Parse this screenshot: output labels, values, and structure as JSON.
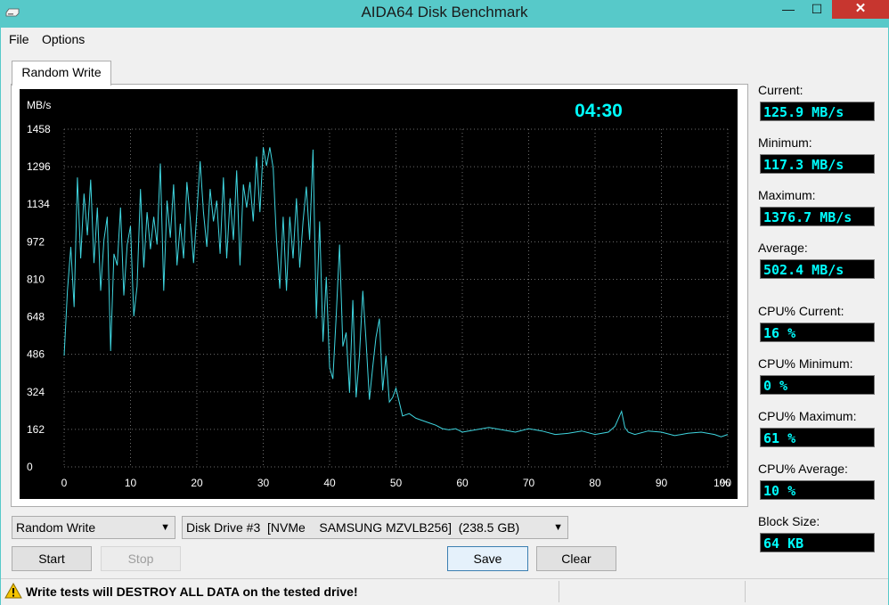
{
  "window": {
    "title": "AIDA64 Disk Benchmark",
    "min_glyph": "—",
    "max_glyph": "☐",
    "close_glyph": "✕"
  },
  "menu": [
    "File",
    "Options"
  ],
  "tab": {
    "label": "Random Write"
  },
  "timer": "04:30",
  "stats": [
    {
      "label": "Current:",
      "value": "125.9 MB/s"
    },
    {
      "label": "Minimum:",
      "value": "117.3 MB/s"
    },
    {
      "label": "Maximum:",
      "value": "1376.7 MB/s"
    },
    {
      "label": "Average:",
      "value": "502.4 MB/s"
    },
    {
      "label": "CPU% Current:",
      "value": "16 %"
    },
    {
      "label": "CPU% Minimum:",
      "value": "0 %"
    },
    {
      "label": "CPU% Maximum:",
      "value": "61 %"
    },
    {
      "label": "CPU% Average:",
      "value": "10 %"
    },
    {
      "label": "Block Size:",
      "value": "64 KB"
    }
  ],
  "controls": {
    "test_select": "Random Write",
    "drive_select": "Disk Drive #3  [NVMe    SAMSUNG MZVLB256]  (238.5 GB)",
    "start": "Start",
    "stop": "Stop",
    "save": "Save",
    "clear": "Clear"
  },
  "status": {
    "warning": "Write tests will DESTROY ALL DATA on the tested drive!"
  },
  "colors": {
    "trace": "#3fd6e0",
    "grid": "#6e6e6e",
    "value_text": "#00ffff",
    "timer": "#00ffff"
  },
  "chart_data": {
    "type": "line",
    "ylabel": "MB/s",
    "xlabel": "%",
    "xlim": [
      0,
      100
    ],
    "ylim": [
      0,
      1458
    ],
    "xticks": [
      0,
      10,
      20,
      30,
      40,
      50,
      60,
      70,
      80,
      90,
      100
    ],
    "yticks": [
      0,
      162,
      324,
      486,
      648,
      810,
      972,
      1134,
      1296,
      1458
    ],
    "x_tick_labels": [
      "0",
      "10",
      "20",
      "30",
      "40",
      "50",
      "60",
      "70",
      "80",
      "90",
      "100"
    ],
    "y_tick_labels": [
      "0",
      "162",
      "324",
      "486",
      "648",
      "810",
      "972",
      "1134",
      "1296",
      "1458"
    ],
    "grid": true,
    "series": [
      {
        "x": [
          0,
          0.5,
          1,
          1.5,
          2,
          2.5,
          3,
          3.5,
          4,
          4.5,
          5,
          5.5,
          6,
          6.5,
          7,
          7.5,
          8,
          8.5,
          9,
          9.5,
          10,
          10.5,
          11,
          11.5,
          12,
          12.5,
          13,
          13.5,
          14,
          14.5,
          15,
          15.5,
          16,
          16.5,
          17,
          17.5,
          18,
          18.5,
          19,
          19.5,
          20,
          20.5,
          21,
          21.5,
          22,
          22.5,
          23,
          23.5,
          24,
          24.5,
          25,
          25.5,
          26,
          26.5,
          27,
          27.5,
          28,
          28.5,
          29,
          29.5,
          30,
          30.5,
          31,
          31.5,
          32,
          32.5,
          33,
          33.5,
          34,
          34.5,
          35,
          35.5,
          36,
          36.5,
          37,
          37.5,
          38,
          38.5,
          39,
          39.5,
          40,
          40.5,
          41,
          41.5,
          42,
          42.5,
          43,
          43.5,
          44,
          44.5,
          45,
          45.5,
          46,
          46.5,
          47,
          47.5,
          48,
          48.5,
          49,
          49.5,
          50,
          51,
          52,
          53,
          54,
          55,
          56,
          57,
          58,
          59,
          60,
          62,
          64,
          66,
          68,
          70,
          72,
          74,
          76,
          78,
          80,
          82,
          83,
          84,
          84.5,
          85,
          86,
          88,
          90,
          92,
          94,
          96,
          98,
          99,
          100
        ],
        "y": [
          480,
          760,
          950,
          690,
          1250,
          900,
          1180,
          1000,
          1240,
          880,
          1120,
          760,
          980,
          1080,
          500,
          920,
          870,
          1120,
          740,
          960,
          1040,
          650,
          780,
          1200,
          860,
          1100,
          940,
          1080,
          960,
          1310,
          760,
          1150,
          990,
          1220,
          870,
          1050,
          900,
          1230,
          1070,
          880,
          1100,
          1320,
          1100,
          950,
          1200,
          1060,
          1150,
          920,
          1250,
          900,
          1160,
          980,
          1280,
          870,
          1220,
          1120,
          1230,
          1060,
          1340,
          1100,
          1380,
          1300,
          1380,
          1290,
          980,
          770,
          1080,
          760,
          1080,
          900,
          1160,
          860,
          1060,
          1210,
          980,
          1370,
          640,
          1060,
          540,
          820,
          430,
          380,
          650,
          960,
          520,
          580,
          320,
          720,
          300,
          480,
          760,
          540,
          290,
          430,
          560,
          640,
          330,
          480,
          280,
          300,
          340,
          220,
          230,
          210,
          200,
          190,
          180,
          165,
          160,
          165,
          150,
          160,
          170,
          160,
          150,
          165,
          155,
          140,
          145,
          155,
          140,
          150,
          175,
          240,
          170,
          150,
          140,
          155,
          150,
          135,
          145,
          150,
          140,
          130,
          140
        ]
      }
    ]
  }
}
